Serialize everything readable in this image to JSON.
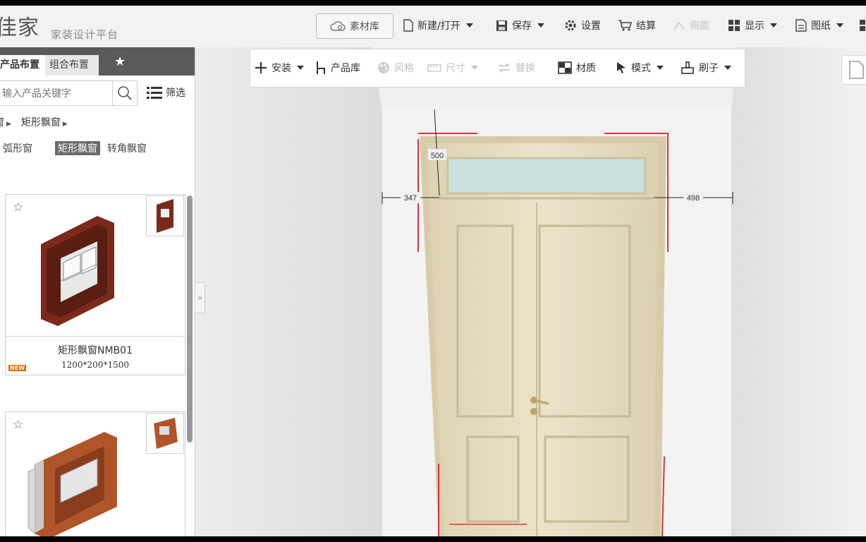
{
  "brand": {
    "logo_text": "佳家",
    "platform": "家装设计平台"
  },
  "topbar": {
    "library_label": "素材库",
    "new_open_label": "新建/打开",
    "save_label": "保存",
    "settings_label": "设置",
    "checkout_label": "结算",
    "view_label": "侧面",
    "display_label": "显示",
    "drawings_label": "图纸"
  },
  "panel": {
    "tabs": [
      "产品布置",
      "组合布置"
    ],
    "search_placeholder": "输入产品关键字",
    "filter_label": "筛选",
    "breadcrumbs": [
      "窗",
      "矩形飘窗"
    ],
    "subcategories": [
      "弧形窗",
      "矩形飘窗",
      "转角飘窗"
    ],
    "products": [
      {
        "name": "矩形飘窗NMB01",
        "size": "1200*200*1500",
        "badge": "NEW"
      },
      {
        "name": "",
        "size": "",
        "badge": ""
      }
    ]
  },
  "toolbar": {
    "install_label": "安装",
    "product_lib_label": "产品库",
    "style_label": "风格",
    "size_label": "尺寸",
    "replace_label": "替换",
    "material_label": "材质",
    "mode_label": "模式",
    "brush_label": "刷子"
  },
  "scene": {
    "dimensions": {
      "top": "500",
      "left": "347",
      "right": "498"
    }
  },
  "colors": {
    "door": "#e6dcc0",
    "frame_red": "#e0313a",
    "glass": "#c9e0dd",
    "new_badge": "#e66a00",
    "window_brown": "#7a2a1a"
  }
}
